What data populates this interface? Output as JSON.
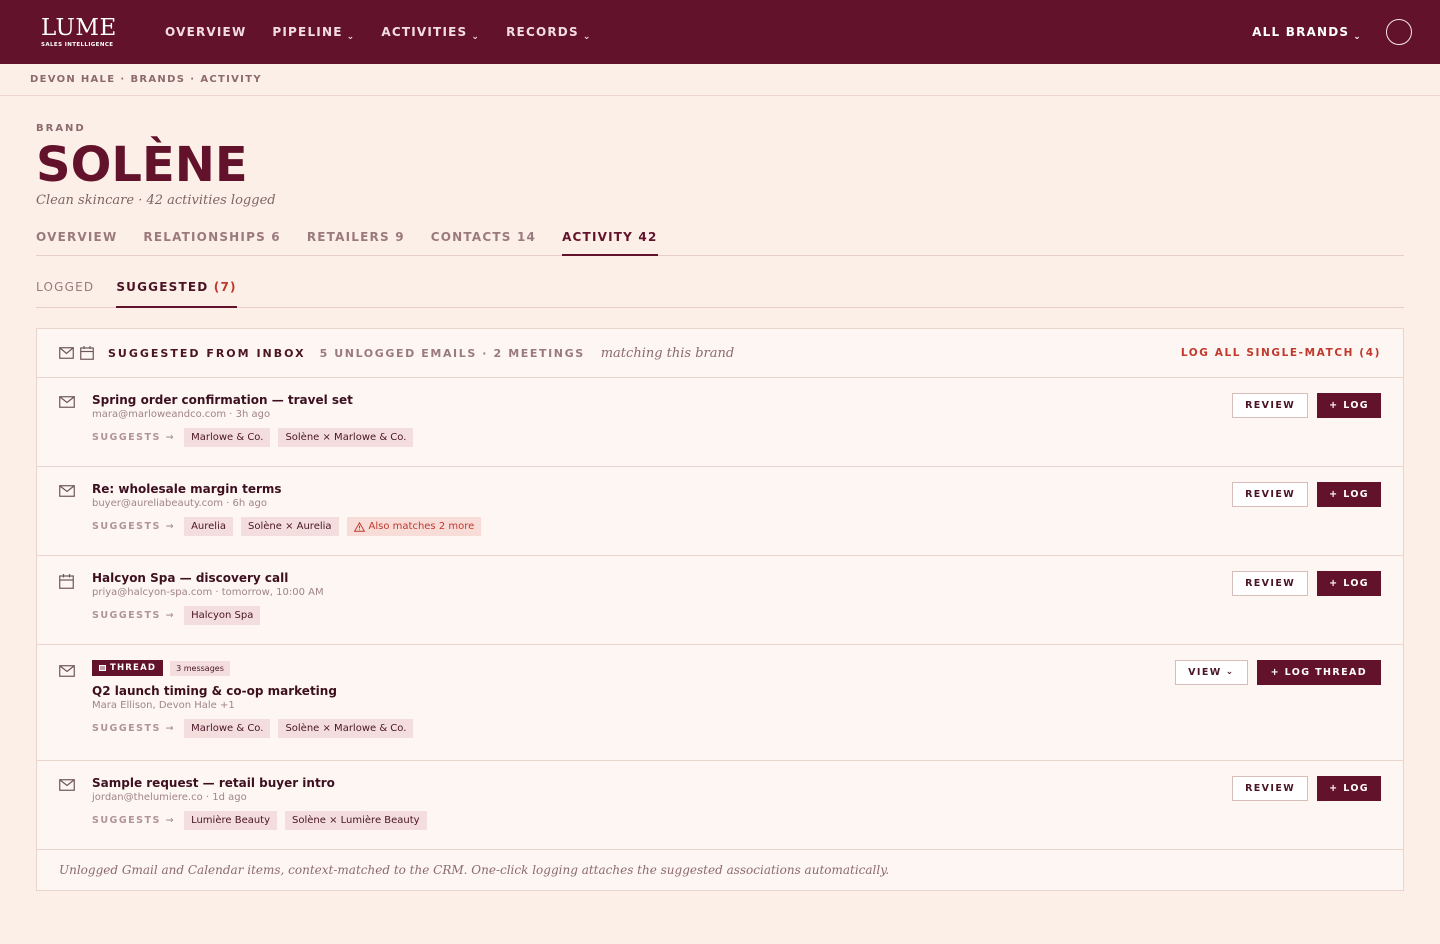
{
  "logo": {
    "word": "LUME",
    "sub": "SALES INTELLIGENCE"
  },
  "nav": {
    "items": [
      "OVERVIEW",
      "PIPELINE",
      "ACTIVITIES",
      "RECORDS"
    ],
    "brands": "ALL BRANDS"
  },
  "breadcrumb": [
    "DEVON HALE",
    "BRANDS",
    "ACTIVITY"
  ],
  "header": {
    "eyebrow": "BRAND",
    "title": "SOLÈNE",
    "subtitle": "Clean skincare · 42 activities logged"
  },
  "tabs": [
    "OVERVIEW",
    "RELATIONSHIPS 6",
    "RETAILERS 9",
    "CONTACTS 14",
    "ACTIVITY 42"
  ],
  "subtabs": {
    "logged": "LOGGED",
    "suggested": "SUGGESTED",
    "suggested_count": "(7)"
  },
  "panel": {
    "title": "SUGGESTED FROM INBOX",
    "meta": "5 UNLOGGED EMAILS · 2 MEETINGS",
    "italic": "matching this brand",
    "action": "LOG ALL SINGLE-MATCH (4)",
    "suggests_label": "SUGGESTS →",
    "review": "REVIEW",
    "log": "+ LOG",
    "view": "VIEW",
    "log_thread": "+ LOG THREAD",
    "thread_badge": "THREAD",
    "footnote": "Unlogged Gmail and Calendar items, context-matched to the CRM. One-click logging attaches the suggested associations automatically."
  },
  "rows": [
    {
      "icon": "mail-icon",
      "title": "Spring order confirmation — travel set",
      "meta": "mara@marloweandco.com · 3h ago",
      "chips": [
        "Marlowe & Co.",
        "Solène × Marlowe & Co."
      ]
    },
    {
      "icon": "mail-icon",
      "title": "Re: wholesale margin terms",
      "meta": "buyer@aureliabeauty.com · 6h ago",
      "chips": [
        "Aurelia",
        "Solène × Aurelia"
      ],
      "warning": "Also matches 2 more"
    },
    {
      "icon": "calendar-icon",
      "title": "Halcyon Spa — discovery call",
      "meta": "priya@halcyon-spa.com · tomorrow, 10:00 AM",
      "chips": [
        "Halcyon Spa"
      ]
    },
    {
      "icon": "mail-icon",
      "title": "Q2 launch timing & co-op marketing",
      "meta": "Mara Ellison, Devon Hale +1",
      "messages": "3 messages",
      "chips": [
        "Marlowe & Co.",
        "Solène × Marlowe & Co."
      ]
    },
    {
      "icon": "mail-icon",
      "title": "Sample request — retail buyer intro",
      "meta": "jordan@thelumiere.co · 1d ago",
      "chips": [
        "Lumière Beauty",
        "Solène × Lumière Beauty"
      ]
    }
  ]
}
